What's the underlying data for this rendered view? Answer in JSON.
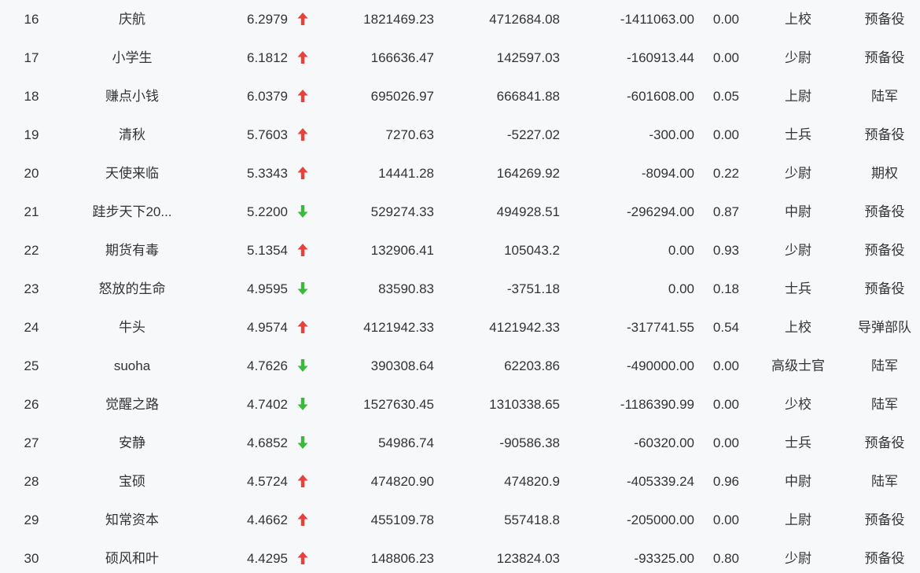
{
  "colors": {
    "up": "#e8403a",
    "down": "#3cb83c"
  },
  "rows": [
    {
      "rank": "16",
      "name": "庆航",
      "score": "6.2979",
      "trend": "up",
      "v1": "1821469.23",
      "v2": "4712684.08",
      "v3": "-1411063.00",
      "ratio": "0.00",
      "rank_title": "上校",
      "unit": "预备役"
    },
    {
      "rank": "17",
      "name": "小学生",
      "score": "6.1812",
      "trend": "up",
      "v1": "166636.47",
      "v2": "142597.03",
      "v3": "-160913.44",
      "ratio": "0.00",
      "rank_title": "少尉",
      "unit": "预备役"
    },
    {
      "rank": "18",
      "name": "赚点小钱",
      "score": "6.0379",
      "trend": "up",
      "v1": "695026.97",
      "v2": "666841.88",
      "v3": "-601608.00",
      "ratio": "0.05",
      "rank_title": "上尉",
      "unit": "陆军"
    },
    {
      "rank": "19",
      "name": "清秋",
      "score": "5.7603",
      "trend": "up",
      "v1": "7270.63",
      "v2": "-5227.02",
      "v3": "-300.00",
      "ratio": "0.00",
      "rank_title": "士兵",
      "unit": "预备役"
    },
    {
      "rank": "20",
      "name": "天使来临",
      "score": "5.3343",
      "trend": "up",
      "v1": "14441.28",
      "v2": "164269.92",
      "v3": "-8094.00",
      "ratio": "0.22",
      "rank_title": "少尉",
      "unit": "期权"
    },
    {
      "rank": "21",
      "name": "跬步天下20...",
      "score": "5.2200",
      "trend": "down",
      "v1": "529274.33",
      "v2": "494928.51",
      "v3": "-296294.00",
      "ratio": "0.87",
      "rank_title": "中尉",
      "unit": "预备役"
    },
    {
      "rank": "22",
      "name": "期货有毒",
      "score": "5.1354",
      "trend": "up",
      "v1": "132906.41",
      "v2": "105043.2",
      "v3": "0.00",
      "ratio": "0.93",
      "rank_title": "少尉",
      "unit": "预备役"
    },
    {
      "rank": "23",
      "name": "怒放的生命",
      "score": "4.9595",
      "trend": "down",
      "v1": "83590.83",
      "v2": "-3751.18",
      "v3": "0.00",
      "ratio": "0.18",
      "rank_title": "士兵",
      "unit": "预备役"
    },
    {
      "rank": "24",
      "name": "牛头",
      "score": "4.9574",
      "trend": "up",
      "v1": "4121942.33",
      "v2": "4121942.33",
      "v3": "-317741.55",
      "ratio": "0.54",
      "rank_title": "上校",
      "unit": "导弹部队"
    },
    {
      "rank": "25",
      "name": "suoha",
      "score": "4.7626",
      "trend": "down",
      "v1": "390308.64",
      "v2": "62203.86",
      "v3": "-490000.00",
      "ratio": "0.00",
      "rank_title": "高级士官",
      "unit": "陆军"
    },
    {
      "rank": "26",
      "name": "觉醒之路",
      "score": "4.7402",
      "trend": "down",
      "v1": "1527630.45",
      "v2": "1310338.65",
      "v3": "-1186390.99",
      "ratio": "0.00",
      "rank_title": "少校",
      "unit": "陆军"
    },
    {
      "rank": "27",
      "name": "安静",
      "score": "4.6852",
      "trend": "down",
      "v1": "54986.74",
      "v2": "-90586.38",
      "v3": "-60320.00",
      "ratio": "0.00",
      "rank_title": "士兵",
      "unit": "预备役"
    },
    {
      "rank": "28",
      "name": "宝硕",
      "score": "4.5724",
      "trend": "up",
      "v1": "474820.90",
      "v2": "474820.9",
      "v3": "-405339.24",
      "ratio": "0.96",
      "rank_title": "中尉",
      "unit": "陆军"
    },
    {
      "rank": "29",
      "name": "知常资本",
      "score": "4.4662",
      "trend": "up",
      "v1": "455109.78",
      "v2": "557418.8",
      "v3": "-205000.00",
      "ratio": "0.00",
      "rank_title": "上尉",
      "unit": "预备役"
    },
    {
      "rank": "30",
      "name": "硕风和叶",
      "score": "4.4295",
      "trend": "up",
      "v1": "148806.23",
      "v2": "123824.03",
      "v3": "-93325.00",
      "ratio": "0.80",
      "rank_title": "少尉",
      "unit": "预备役"
    }
  ]
}
